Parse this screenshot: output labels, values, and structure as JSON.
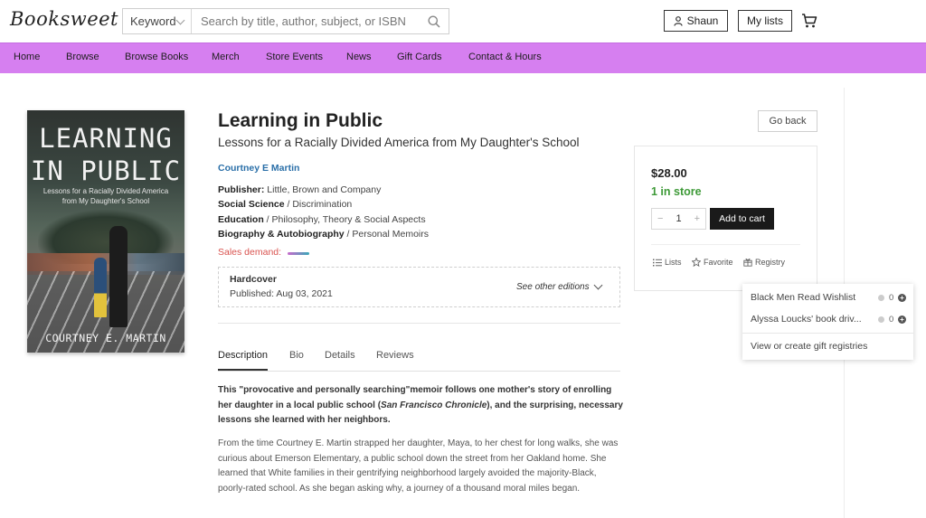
{
  "header": {
    "logo": "Booksweet",
    "search": {
      "keyword_label": "Keyword",
      "placeholder": "Search by title, author, subject, or ISBN"
    },
    "user_label": "Shaun",
    "lists_label": "My lists"
  },
  "nav": {
    "items": [
      "Home",
      "Browse",
      "Browse Books",
      "Merch",
      "Store Events",
      "News",
      "Gift Cards",
      "Contact & Hours"
    ]
  },
  "book": {
    "cover": {
      "title_line1": "LEARNING",
      "title_line2": "IN PUBLIC",
      "subtitle_line1": "Lessons for a Racially Divided America",
      "subtitle_line2": "from My Daughter's School",
      "author": "COURTNEY E. MARTIN"
    },
    "title": "Learning in Public",
    "subtitle": "Lessons for a Racially Divided America from My Daughter's School",
    "author": "Courtney E Martin",
    "publisher_label": "Publisher:",
    "publisher": "Little, Brown and Company",
    "categories": [
      {
        "main": "Social Science",
        "sub": "Discrimination"
      },
      {
        "main": "Education",
        "sub": "Philosophy, Theory & Social Aspects"
      },
      {
        "main": "Biography & Autobiography",
        "sub": "Personal Memoirs"
      }
    ],
    "sales_demand_label": "Sales demand:",
    "edition": {
      "format": "Hardcover",
      "published": "Published: Aug 03, 2021",
      "other_editions": "See other editions"
    }
  },
  "tabs": [
    "Description",
    "Bio",
    "Details",
    "Reviews"
  ],
  "description": {
    "bold_part1": "This \"provocative and personally searching\"memoir follows one mother's story of enrolling her daughter in a local public school (",
    "bold_italic": "San Francisco Chronicle",
    "bold_part2": "), and the surprising, necessary lessons she learned with her neighbors.",
    "body": "From the time Courtney E. Martin strapped her daughter, Maya, to her chest for long walks, she was curious about Emerson Elementary, a public school down the street from her Oakland home. She learned that White families in their gentrifying neighborhood largely avoided the majority-Black, poorly-rated school. As she began asking why, a journey of a thousand moral miles began."
  },
  "purchase": {
    "go_back": "Go back",
    "price": "$28.00",
    "stock": "1 in store",
    "qty": "1",
    "qty_minus": "−",
    "qty_plus": "+",
    "add_to_cart": "Add to cart",
    "actions": [
      "Lists",
      "Favorite",
      "Registry"
    ]
  },
  "registry_dropdown": {
    "items": [
      {
        "name": "Black Men Read Wishlist",
        "count": "0"
      },
      {
        "name": "Alyssa Loucks' book driv...",
        "count": "0"
      }
    ],
    "footer": "View or create gift registries"
  },
  "colors": {
    "nav_bg": "#d67ff0",
    "author_link": "#2a6fa8",
    "stock_green": "#3e9a38",
    "demand_red": "#d9534f"
  }
}
